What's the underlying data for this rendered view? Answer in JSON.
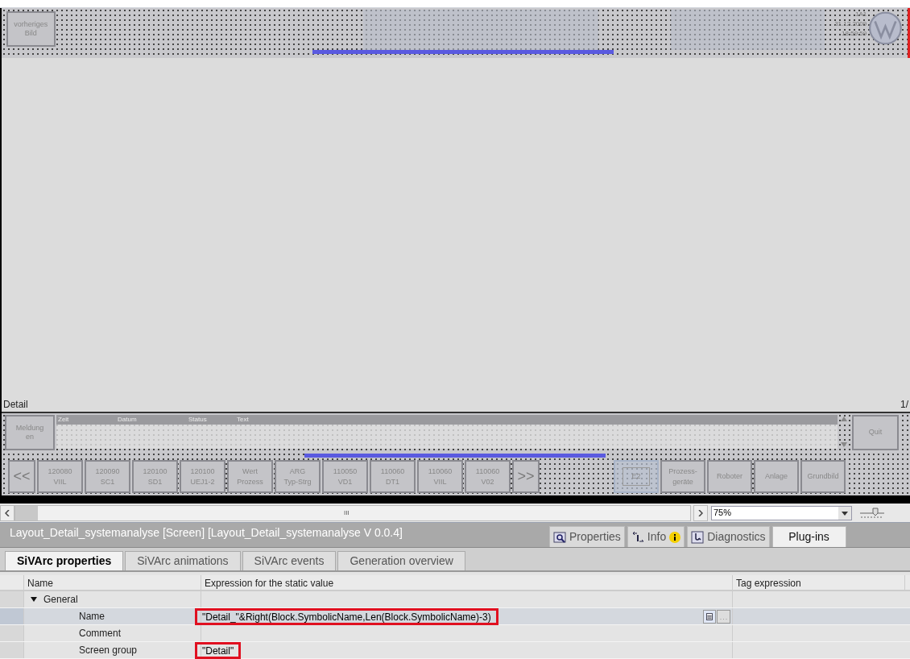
{
  "hmi_header": {
    "prev_button": [
      "vorheriges",
      "Bild"
    ],
    "info": [
      "1A1",
      "31.12.2009",
      "18:59:59"
    ]
  },
  "canvas": {
    "label": "Detail",
    "page": "1/"
  },
  "alarm_view": {
    "button": [
      "Meldung",
      "en"
    ],
    "columns": [
      "Zeit",
      "Datum",
      "Status",
      "Text"
    ],
    "quit_button": "Quit"
  },
  "nav_buttons": [
    {
      "kind": "arrow",
      "lines": [
        "<<"
      ]
    },
    {
      "kind": "key",
      "lines": [
        "120080",
        "VIIL"
      ]
    },
    {
      "kind": "key",
      "lines": [
        "120090",
        "SC1"
      ]
    },
    {
      "kind": "key",
      "lines": [
        "120100",
        "SD1"
      ]
    },
    {
      "kind": "key",
      "lines": [
        "120100",
        "UEJ1-2"
      ]
    },
    {
      "kind": "key",
      "lines": [
        "Wert",
        "Prozess"
      ]
    },
    {
      "kind": "key",
      "lines": [
        "ARG",
        "Typ-Strg"
      ]
    },
    {
      "kind": "key",
      "lines": [
        "110050",
        "VD1"
      ]
    },
    {
      "kind": "key",
      "lines": [
        "110060",
        "DT1"
      ]
    },
    {
      "kind": "key",
      "lines": [
        "110060",
        "VIIL"
      ]
    },
    {
      "kind": "key",
      "lines": [
        "110060",
        "V02"
      ]
    },
    {
      "kind": "arrow",
      "lines": [
        ">>"
      ]
    }
  ],
  "area_buttons": [
    {
      "kind": "framed",
      "lines": [
        "E2"
      ]
    },
    {
      "kind": "key",
      "lines": [
        "Prozess-",
        "geräte"
      ]
    },
    {
      "kind": "key",
      "lines": [
        "Roboter"
      ]
    },
    {
      "kind": "key",
      "lines": [
        "Anlage"
      ]
    },
    {
      "kind": "key",
      "lines": [
        "Grundbild"
      ]
    }
  ],
  "editor_bar": {
    "scroll_mark": "III",
    "zoom": "75%"
  },
  "inspector": {
    "title": "Layout_Detail_systemanalyse [Screen] [Layout_Detail_systemanalyse V 0.0.4]",
    "tabs": [
      {
        "label": "Properties",
        "selected": false
      },
      {
        "label": "Info",
        "selected": false
      },
      {
        "label": "Diagnostics",
        "selected": false
      },
      {
        "label": "Plug-ins",
        "selected": true
      }
    ],
    "subtabs": [
      {
        "label": "SiVArc properties",
        "selected": true
      },
      {
        "label": "SiVArc animations",
        "selected": false
      },
      {
        "label": "SiVArc events",
        "selected": false
      },
      {
        "label": "Generation overview",
        "selected": false
      }
    ],
    "columns": [
      "Name",
      "Expression for the static value",
      "Tag expression"
    ],
    "rows": [
      {
        "name": "General",
        "expanded": true,
        "children": [
          {
            "name": "Name",
            "value": "\"Detail_\"&Right(Block.SymbolicName,Len(Block.SymbolicName)-3)",
            "selected": true,
            "highlighted": true
          },
          {
            "name": "Comment",
            "selected": false
          },
          {
            "name": "Screen group",
            "value": "\"Detail\"",
            "selected": false,
            "highlighted": true
          }
        ]
      }
    ]
  }
}
